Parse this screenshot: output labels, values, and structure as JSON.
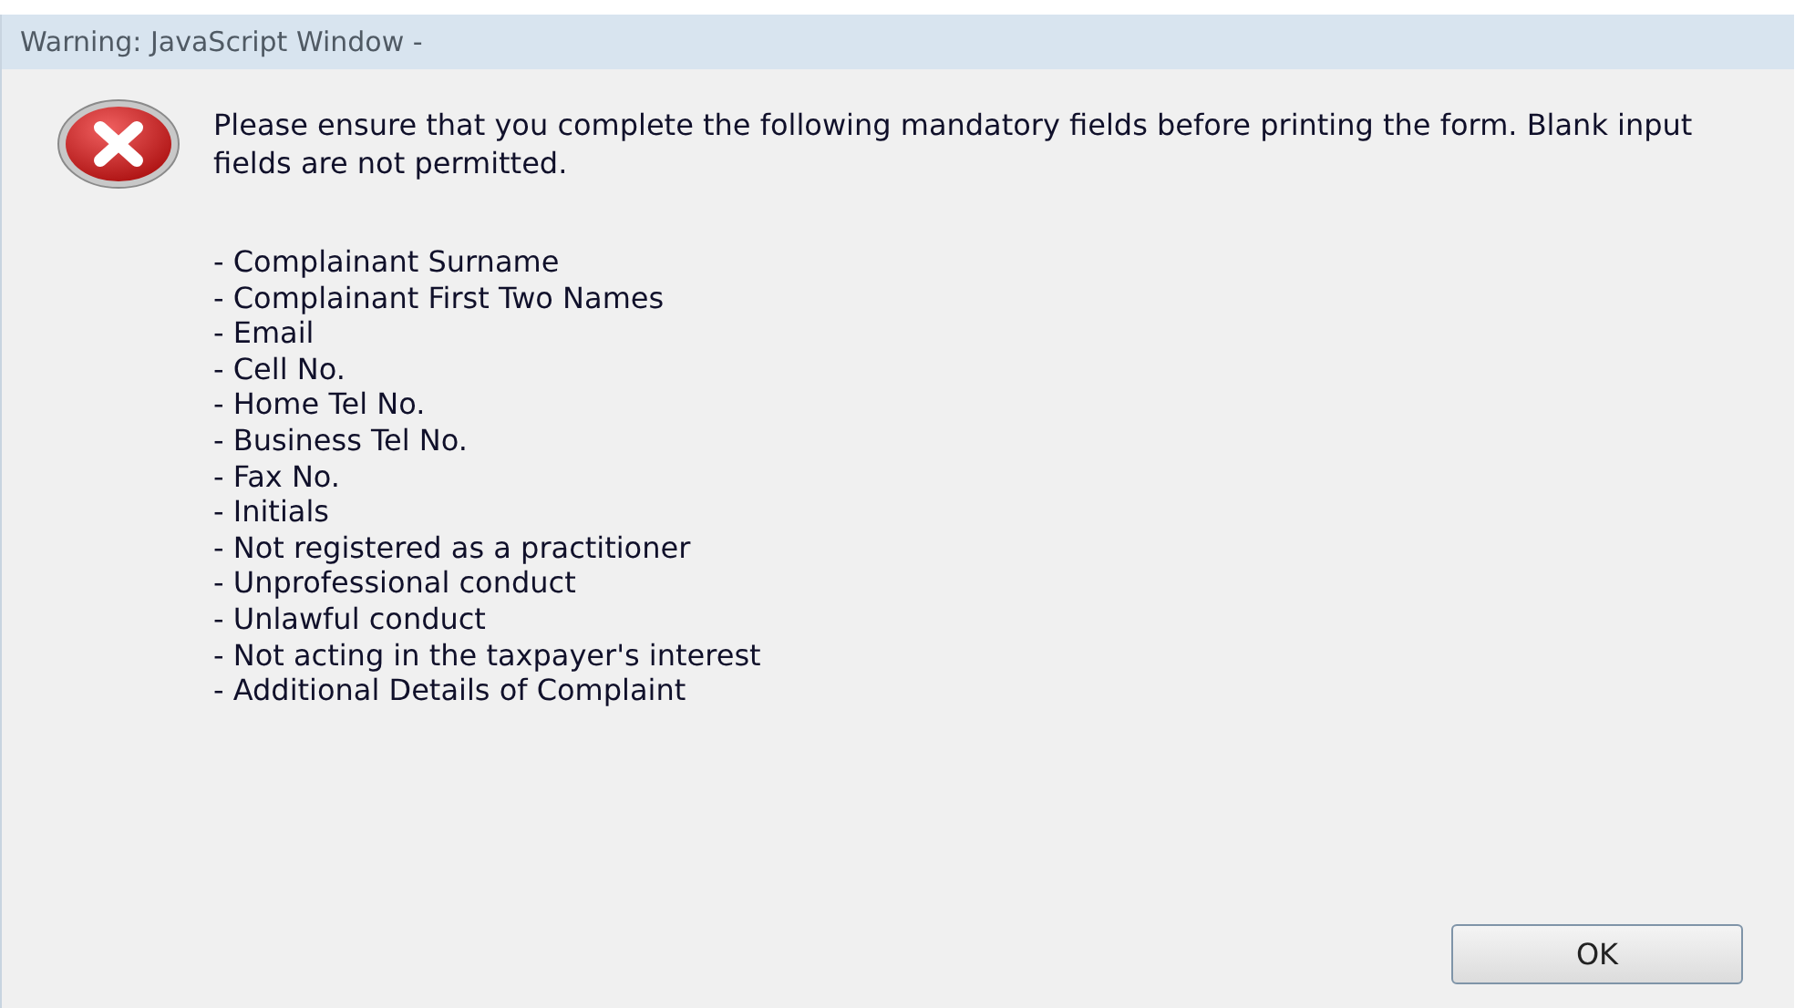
{
  "window": {
    "title": "Warning: JavaScript Window -"
  },
  "message": "Please ensure that you complete the following mandatory fields before printing the form. Blank input fields are not permitted.",
  "fields": [
    "- Complainant Surname",
    "- Complainant First Two Names",
    "- Email",
    "- Cell No.",
    "- Home Tel No.",
    "- Business Tel No.",
    "- Fax No.",
    "- Initials",
    "- Not registered as a practitioner",
    "- Unprofessional conduct",
    "- Unlawful conduct",
    "- Not acting in the taxpayer's interest",
    "- Additional Details of Complaint"
  ],
  "buttons": [
    "OK"
  ]
}
